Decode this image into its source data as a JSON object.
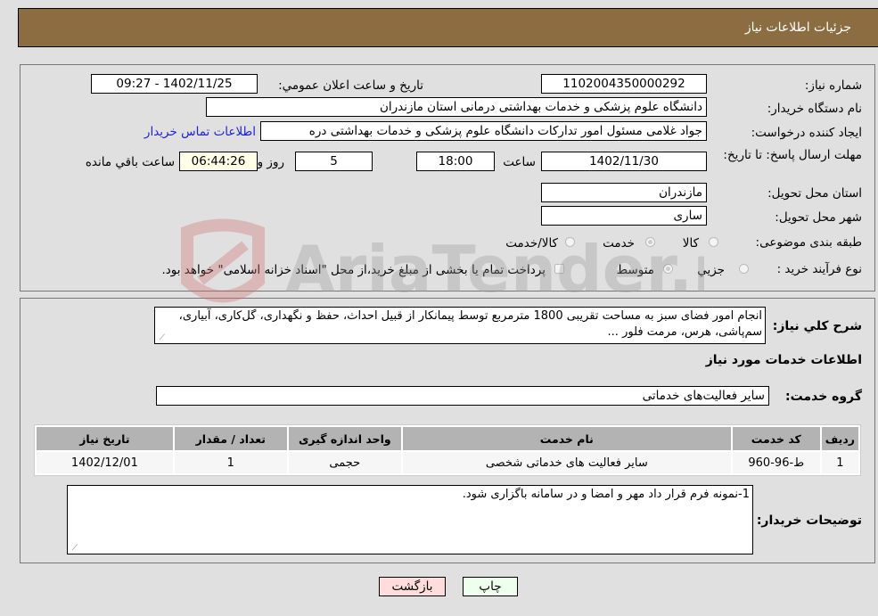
{
  "header": {
    "title": "جزئیات اطلاعات نیاز"
  },
  "form": {
    "need_number": {
      "label": "شماره نیاز:",
      "value": "1102004350000292"
    },
    "announce_datetime": {
      "label": "تاريخ و ساعت اعلان عمومي:",
      "value": "1402/11/25 - 09:27"
    },
    "buyer_org": {
      "label": "نام دستگاه خريدار:",
      "value": "دانشگاه علوم پزشکی و خدمات بهداشتی  درمانی استان مازندران"
    },
    "creator": {
      "label": "ايجاد کننده درخواست:",
      "value": "جواد غلامی مسئول امور تدارکات دانشگاه علوم پزشکی و خدمات بهداشتی  دره",
      "contact_link": "اطلاعات تماس خريدار"
    },
    "deadline": {
      "label": "مهلت ارسال پاسخ: تا تاريخ:",
      "date": "1402/11/30",
      "time_label": "ساعت",
      "time": "18:00",
      "days": "5",
      "days_label": "روز و",
      "remaining": "06:44:26",
      "remaining_label": "ساعت باقي مانده"
    },
    "delivery_province": {
      "label": "استان محل تحويل:",
      "value": "مازندران"
    },
    "delivery_city": {
      "label": "شهر محل تحويل:",
      "value": "ساری"
    },
    "category": {
      "label": "طبقه بندی موضوعی:",
      "options": [
        "کالا",
        "خدمت",
        "کالا/خدمت"
      ],
      "selected": "خدمت"
    },
    "purchase_type": {
      "label": "نوع فرآيند خريد :",
      "options": [
        "جزيي",
        "متوسط"
      ],
      "selected": "متوسط",
      "treasury_note": "پرداخت تمام يا بخشی از مبلغ خريد،از محل \"اسناد خزانه اسلامی\" خواهد بود."
    }
  },
  "details": {
    "description_label": "شرح کلي نياز:",
    "description": "انجام امور  فضای سبز به مساحت تقریبی 1800 مترمربع توسط پیمانکار از قبیل احداث، حفظ و نگهداری، گل‌کاری، آبیاری، سم‌پاشی، هرس، مرمت فلور ...",
    "services_heading": "اطلاعات خدمات مورد نياز",
    "service_group_label": "گروه خدمت:",
    "service_group": "ساير فعاليت‌های خدماتی",
    "table": {
      "headers": [
        "رديف",
        "کد خدمت",
        "نام خدمت",
        "واحد اندازه گيری",
        "تعداد / مقدار",
        "تاريخ نياز"
      ],
      "rows": [
        [
          "1",
          "ط-96-960",
          "ساير فعاليت های خدماتی شخصی",
          "حجمی",
          "1",
          "1402/12/01"
        ]
      ]
    },
    "buyer_notes_label": "توضيحات خريدار:",
    "buyer_notes": "1-نمونه فرم قرار داد مهر و امضا و در سامانه باگزاری شود."
  },
  "buttons": {
    "print": "چاپ",
    "back": "بازگشت"
  },
  "watermark": {
    "text": "AriaTender.neT"
  }
}
